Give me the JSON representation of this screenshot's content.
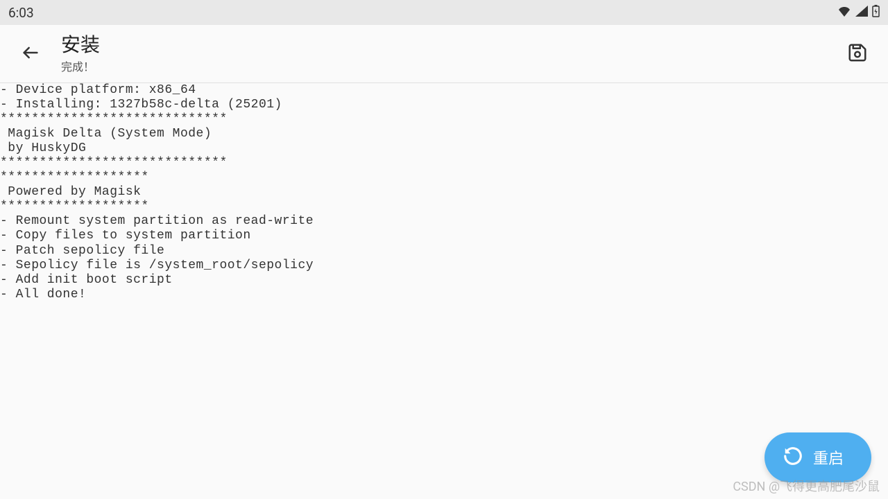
{
  "status_bar": {
    "time": "6:03"
  },
  "header": {
    "title": "安装",
    "subtitle": "完成！"
  },
  "log": {
    "lines": [
      "- Device platform: x86_64",
      "- Installing: 1327b58c-delta (25201)",
      "*****************************",
      " Magisk Delta (System Mode)",
      " by HuskyDG",
      "*****************************",
      "*******************",
      " Powered by Magisk",
      "*******************",
      "- Remount system partition as read-write",
      "- Copy files to system partition",
      "- Patch sepolicy file",
      "- Sepolicy file is /system_root/sepolicy",
      "- Add init boot script",
      "- All done!"
    ]
  },
  "fab": {
    "label": "重启"
  },
  "watermark": "CSDN @飞得更高肥尾沙鼠",
  "colors": {
    "accent": "#4faff0",
    "status_bg": "#e8e8e8",
    "page_bg": "#fafafa"
  }
}
